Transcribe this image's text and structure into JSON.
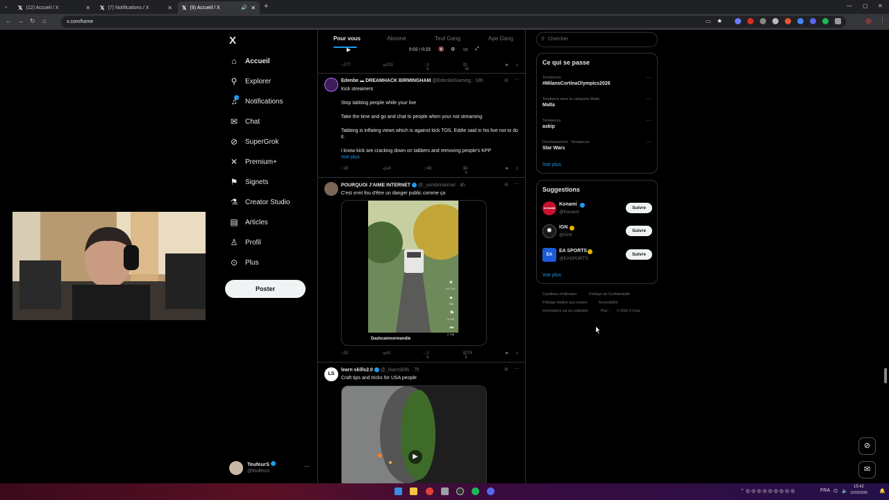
{
  "browser": {
    "tabs": [
      {
        "title": "(12) Accueil / X",
        "active": false
      },
      {
        "title": "(7) Notifications / X",
        "active": false
      },
      {
        "title": "(9) Accueil / X",
        "active": true
      }
    ],
    "url": "x.com/home"
  },
  "nav": {
    "logo": "X",
    "items": [
      {
        "label": "Accueil",
        "icon": "home-icon"
      },
      {
        "label": "Explorer",
        "icon": "search-icon"
      },
      {
        "label": "Notifications",
        "icon": "bell-icon"
      },
      {
        "label": "Chat",
        "icon": "mail-icon"
      },
      {
        "label": "SuperGrok",
        "icon": "grok-icon"
      },
      {
        "label": "Premium+",
        "icon": "x-icon"
      },
      {
        "label": "Signets",
        "icon": "bookmark-icon"
      },
      {
        "label": "Creator Studio",
        "icon": "flask-icon"
      },
      {
        "label": "Articles",
        "icon": "article-icon"
      },
      {
        "label": "Profil",
        "icon": "person-icon"
      },
      {
        "label": "Plus",
        "icon": "more-icon"
      }
    ],
    "post_button": "Poster",
    "account": {
      "name": "TeufeurS",
      "handle": "@teufeurs",
      "more": "···"
    }
  },
  "feed": {
    "tabs": [
      "Pour vous",
      "Abonné",
      "Teuf Gang",
      "Ape Gang"
    ],
    "video_controls": {
      "time": "0:02 / 0:23"
    },
    "top_actions": {
      "replies": "277",
      "reposts": "231",
      "likes": "1 k",
      "views": "1 M"
    },
    "posts": [
      {
        "name": "Edenbe",
        "title_extra": "DREAMHACK BIRMINGHAM",
        "handle": "@EdenbeGaming",
        "time": "· 18h",
        "lines": [
          "Kick streamers",
          "Stop tabbing people while your live",
          "Take the time and go and chat to people when your not streaming",
          "Tabbing is inflating views which is against kick TOS, Eddie said in his live not to do it.",
          "I know kick are cracking down on tabbers and removing people's KPP"
        ],
        "more": "Voir plus",
        "actions": {
          "replies": "18",
          "reposts": "14",
          "likes": "48",
          "views": "4 k"
        }
      },
      {
        "name": "POURQUOI J'AIME INTERNET",
        "handle": "@_sombrinternet",
        "time": "· 4h",
        "text": "C'est vrmt fou d'être un danger public comme ça",
        "video_caption": "Dashcamnormandie",
        "video_counts": {
          "likes": "127,4 k",
          "comments": "765",
          "saves": "4 143",
          "shares": "2 728"
        },
        "actions": {
          "replies": "33",
          "reposts": "41",
          "likes": "1 k",
          "views": "274 k"
        }
      },
      {
        "name": "learn skills2.0",
        "handle": "@_learnskills",
        "time": "· 7h",
        "text": "Craft tips and tricks for USA people"
      }
    ]
  },
  "right": {
    "search_placeholder": "Chercher",
    "trends": {
      "title": "Ce qui se passe",
      "items": [
        {
          "context": "Tendances",
          "name": "#MilanoCortinaOlympics2026"
        },
        {
          "context": "Tendance dans la catégorie Malte",
          "name": "Malta"
        },
        {
          "context": "Tendances",
          "name": "askip"
        },
        {
          "context": "Divertissement · Tendances",
          "name": "Star Wars"
        }
      ],
      "more": "Voir plus"
    },
    "suggestions": {
      "title": "Suggestions",
      "items": [
        {
          "name": "Konami",
          "handle": "@Konami",
          "button": "Suivre",
          "color": "#c8102e"
        },
        {
          "name": "IGN",
          "handle": "@IGN",
          "button": "Suivre",
          "color": "#1a1a1a"
        },
        {
          "name": "EA SPORTS",
          "handle": "@EASPORTS",
          "button": "Suivre",
          "color": "#1e5bd8"
        }
      ],
      "more": "Voir plus"
    },
    "footer": [
      "Conditions d'utilisation",
      "Politique de Confidentialité",
      "Politique relative aux cookies",
      "Accessibilité",
      "Informations sur les publicités",
      "Plus ···",
      "© 2026 X Corp."
    ]
  },
  "taskbar": {
    "lang": "FRA",
    "time": "15:42",
    "date": "15/02/2026"
  }
}
